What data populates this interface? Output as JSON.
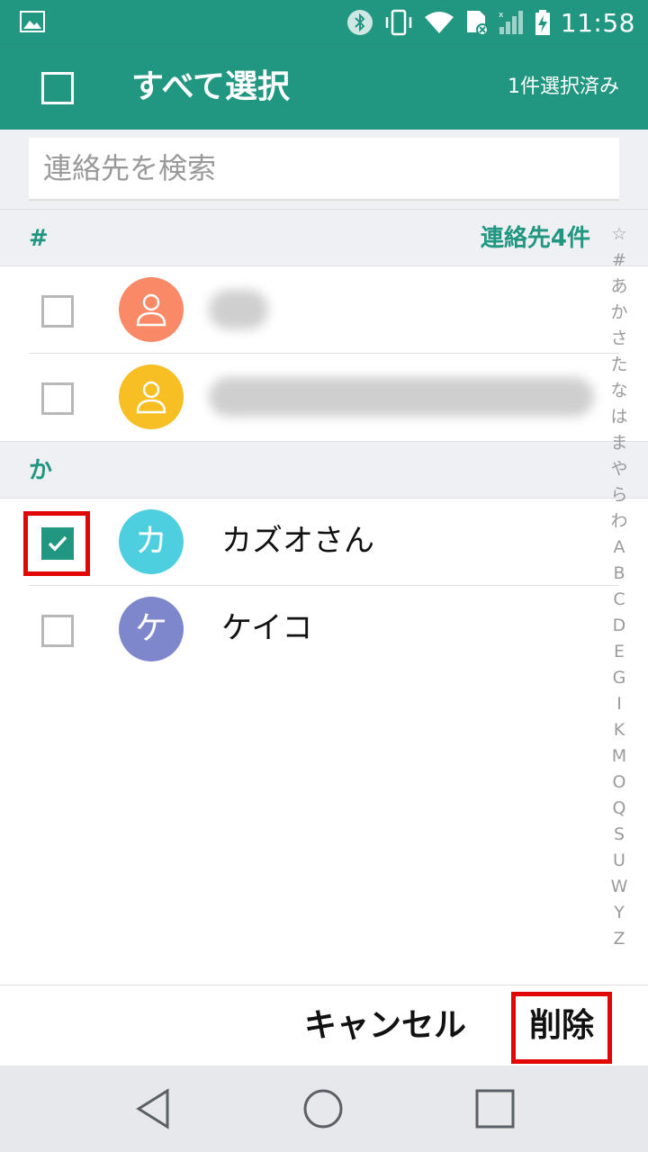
{
  "status_bar": {
    "time": "11:58",
    "icons": [
      "gallery-icon",
      "bluetooth-icon",
      "vibrate-icon",
      "wifi-icon",
      "sd-card-icon",
      "signal-icon",
      "battery-charging-icon"
    ]
  },
  "toolbar": {
    "title": "すべて選択",
    "selected_count": "1件選択済み"
  },
  "search": {
    "placeholder": "連絡先を検索"
  },
  "sections": [
    {
      "letter": "#",
      "total": "連絡先4件",
      "contacts": [
        {
          "name": "",
          "avatar_color": "#fa8a67",
          "avatar": "person-icon",
          "checked": false
        },
        {
          "name": "",
          "avatar_color": "#f7bf24",
          "avatar": "person-icon",
          "checked": false
        }
      ]
    },
    {
      "letter": "か",
      "contacts": [
        {
          "name": "カズオさん",
          "avatar_letter": "カ",
          "avatar_color": "#4ecfe0",
          "checked": true
        },
        {
          "name": "ケイコ",
          "avatar_letter": "ケ",
          "avatar_color": "#7e87cc",
          "checked": false
        }
      ]
    }
  ],
  "index_bar": [
    "☆",
    "#",
    "あ",
    "か",
    "さ",
    "た",
    "な",
    "は",
    "ま",
    "や",
    "ら",
    "わ",
    "A",
    "B",
    "C",
    "D",
    "E",
    "G",
    "I",
    "K",
    "M",
    "O",
    "Q",
    "S",
    "U",
    "W",
    "Y",
    "Z"
  ],
  "actions": {
    "cancel": "キャンセル",
    "delete": "削除"
  },
  "colors": {
    "accent": "#219680",
    "highlight": "#e10600"
  }
}
